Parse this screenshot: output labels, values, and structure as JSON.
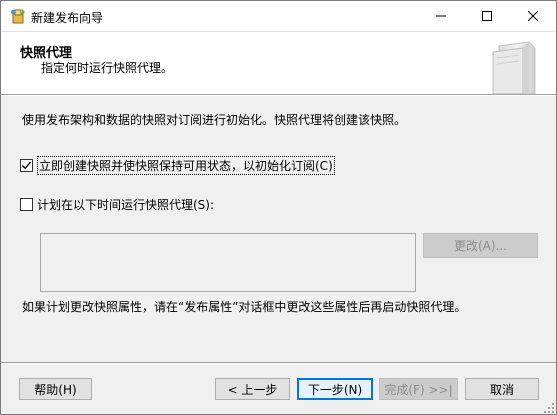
{
  "window": {
    "title": "新建发布向导"
  },
  "header": {
    "title": "快照代理",
    "subtitle": "指定何时运行快照代理。"
  },
  "description": "使用发布架构和数据的快照对订阅进行初始化。快照代理将创建该快照。",
  "options": {
    "create_now": {
      "label": "立即创建快照并使快照保持可用状态，以初始化订阅(C)",
      "checked": true
    },
    "schedule": {
      "label": "计划在以下时间运行快照代理(S):",
      "checked": false
    }
  },
  "schedule_box": {
    "text": ""
  },
  "change_button": {
    "label": "更改(A)..."
  },
  "note": "如果计划更改快照属性，请在“发布属性”对话框中更改这些属性后再启动快照代理。",
  "footer": {
    "help_label": "帮助(H)",
    "back_label": "< 上一步",
    "next_label": "下一步(N)",
    "finish_label": "完成(F) >>|",
    "cancel_label": "取消"
  },
  "colors": {
    "accent": "#0078d7",
    "dialog_bg": "#f0f0f0",
    "header_bg": "#ffffff"
  }
}
